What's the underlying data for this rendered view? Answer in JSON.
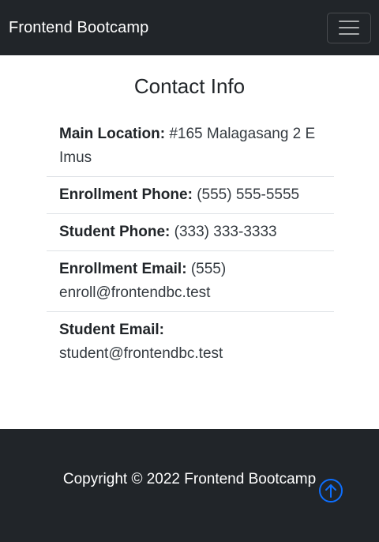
{
  "navbar": {
    "brand": "Frontend Bootcamp",
    "toggler_icon": "hamburger-menu-icon"
  },
  "contact": {
    "title": "Contact Info",
    "items": [
      {
        "label": "Main Location:",
        "value": "#165 Malagasang 2 E Imus"
      },
      {
        "label": "Enrollment Phone:",
        "value": "(555) 555-5555"
      },
      {
        "label": "Student Phone:",
        "value": "(333) 333-3333"
      },
      {
        "label": "Enrollment Email:",
        "value": "(555) enroll@frontendbc.test"
      },
      {
        "label": "Student Email:",
        "value": "student@frontendbc.test"
      }
    ]
  },
  "footer": {
    "copyright": "Copyright © 2022 Frontend Bootcamp",
    "back_to_top_icon": "arrow-up-circle-icon"
  },
  "colors": {
    "dark": "#212529",
    "accent": "#0d6efd"
  }
}
